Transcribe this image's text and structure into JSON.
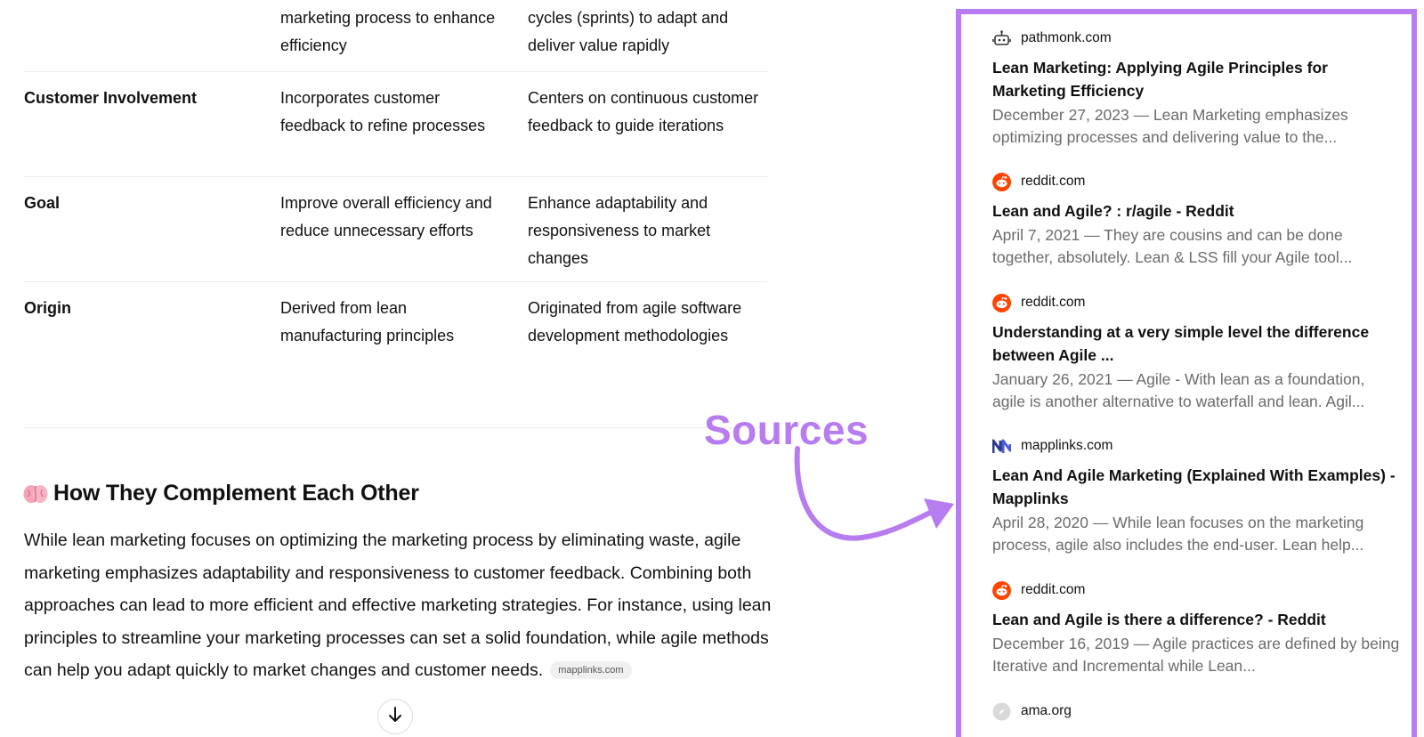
{
  "table": {
    "rows": [
      {
        "label": "",
        "lean": "marketing process to enhance efficiency",
        "agile": "cycles (sprints) to adapt and deliver value rapidly"
      },
      {
        "label": "Customer Involvement",
        "lean": "Incorporates customer feedback to refine processes",
        "agile": "Centers on continuous customer feedback to guide iterations"
      },
      {
        "label": "Goal",
        "lean": "Improve overall efficiency and reduce unnecessary efforts",
        "agile": "Enhance adaptability and responsiveness to market changes"
      },
      {
        "label": "Origin",
        "lean": "Derived from lean manufacturing principles",
        "agile": "Originated from agile software development methodologies"
      }
    ]
  },
  "section": {
    "icon": "brain-icon",
    "heading": "How They Complement Each Other",
    "paragraph": "While lean marketing focuses on optimizing the marketing process by eliminating waste, agile marketing emphasizes adaptability and responsiveness to customer feedback. Combining both approaches can lead to more efficient and effective marketing strategies. For instance, using lean principles to streamline your marketing processes can set a solid foundation, while agile methods can help you adapt quickly to market changes and customer needs.",
    "citation": "mapplinks.com"
  },
  "scroll_button": {
    "icon": "arrow-down-icon"
  },
  "annotation": {
    "label": "Sources",
    "color": "#b77cf0"
  },
  "sources": [
    {
      "site": "pathmonk.com",
      "icon": "robot-icon",
      "title": "Lean Marketing: Applying Agile Principles for Marketing Efficiency",
      "snippet": "December 27, 2023 — Lean Marketing emphasizes optimizing processes and delivering value to the..."
    },
    {
      "site": "reddit.com",
      "icon": "reddit-icon",
      "title": "Lean and Agile? : r/agile - Reddit",
      "snippet": "April 7, 2021 — They are cousins and can be done together, absolutely. Lean & LSS fill your Agile tool..."
    },
    {
      "site": "reddit.com",
      "icon": "reddit-icon",
      "title": "Understanding at a very simple level the difference between Agile ...",
      "snippet": "January 26, 2021 — Agile - With lean as a foundation, agile is another alternative to waterfall and lean. Agil..."
    },
    {
      "site": "mapplinks.com",
      "icon": "mapplinks-icon",
      "title": "Lean And Agile Marketing (Explained With Examples) - Mapplinks",
      "snippet": "April 28, 2020 — While lean focuses on the marketing process, agile also includes the end-user. Lean help..."
    },
    {
      "site": "reddit.com",
      "icon": "reddit-icon",
      "title": "Lean and Agile is there a difference? - Reddit",
      "snippet": "December 16, 2019 — Agile practices are defined by being Iterative and Incremental while Lean..."
    },
    {
      "site": "ama.org",
      "icon": "compass-icon",
      "title": "",
      "snippet": ""
    }
  ],
  "colors": {
    "accent": "#b77cf0",
    "reddit": "#ff4500",
    "mapplinks": "#2b3a8f"
  }
}
